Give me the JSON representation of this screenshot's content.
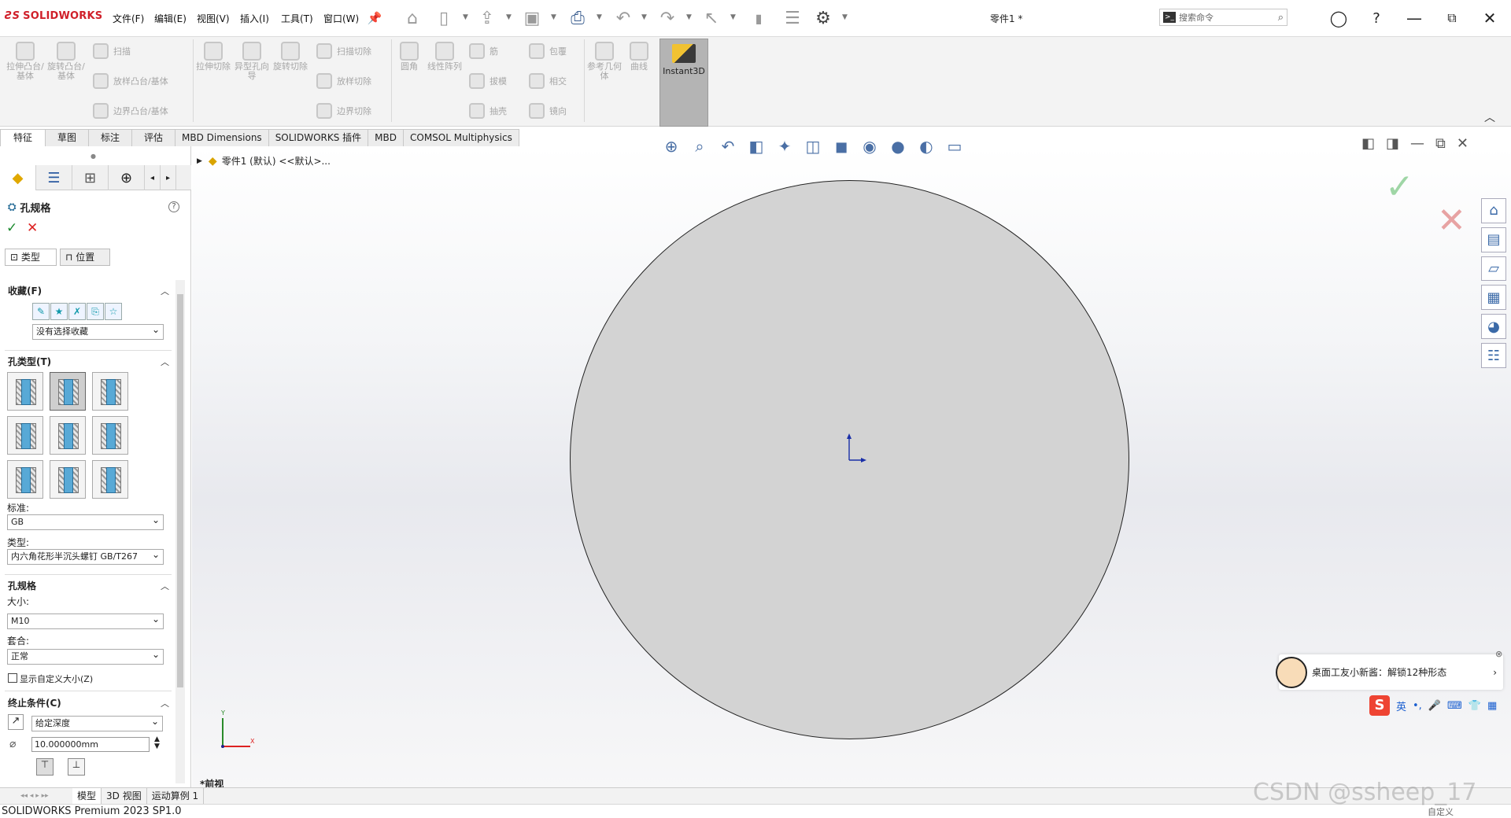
{
  "app": {
    "logo": "SOLIDWORKS",
    "doc_title": "零件1 *",
    "status": "SOLIDWORKS Premium 2023 SP1.0",
    "custom_label": "自定义"
  },
  "menus": [
    "文件(F)",
    "编辑(E)",
    "视图(V)",
    "插入(I)",
    "工具(T)",
    "窗口(W)"
  ],
  "search": {
    "placeholder": "搜索命令"
  },
  "toolbar": {
    "extrude_boss": "拉伸凸台/基体",
    "revolve_boss": "旋转凸台/基体",
    "sweep": "扫描",
    "loft_boss": "放样凸台/基体",
    "boundary_boss": "边界凸台/基体",
    "extrude_cut": "拉伸切除",
    "hole_wizard": "异型孔向导",
    "revolve_cut": "旋转切除",
    "swept_cut": "扫描切除",
    "lofted_cut": "放样切除",
    "boundary_cut": "边界切除",
    "fillet": "圆角",
    "linear_pattern": "线性阵列",
    "rib": "筋",
    "draft": "拔模",
    "shell": "抽壳",
    "wrap": "包覆",
    "intersect": "相交",
    "mirror": "镜向",
    "ref_geometry": "参考几何体",
    "curves": "曲线",
    "instant3d": "Instant3D"
  },
  "tabs": [
    "特征",
    "草图",
    "标注",
    "评估",
    "MBD Dimensions",
    "SOLIDWORKS 插件",
    "MBD",
    "COMSOL Multiphysics"
  ],
  "feature_tree": {
    "root": "零件1 (默认) <<默认>..."
  },
  "property_manager": {
    "title": "孔规格",
    "subtabs": [
      "类型",
      "位置"
    ],
    "favorites": {
      "title": "收藏(F)",
      "selected": "没有选择收藏"
    },
    "hole_type": {
      "title": "孔类型(T)",
      "standard_label": "标准:",
      "standard": "GB",
      "type_label": "类型:",
      "type": "内六角花形半沉头螺钉 GB/T267"
    },
    "hole_spec": {
      "title": "孔规格",
      "size_label": "大小:",
      "size": "M10",
      "fit_label": "套合:",
      "fit": "正常",
      "show_custom": "显示自定义大小(Z)"
    },
    "end_condition": {
      "title": "终止条件(C)",
      "mode": "给定深度",
      "depth": "10.000000mm"
    }
  },
  "viewport": {
    "view_label": "*前视",
    "axis_x": "X",
    "axis_y": "Y"
  },
  "bottom_tabs": [
    "模型",
    "3D 视图",
    "运动算例 1"
  ],
  "notification": {
    "text": "桌面工友小新酱：解锁12种形态"
  },
  "ime": {
    "lang": "英"
  },
  "watermark": "CSDN @ssheep_17",
  "colors": {
    "accent": "#d0202a",
    "disc": "#d3d3d3",
    "ok": "#1b8a2e",
    "cancel": "#dd2222"
  }
}
